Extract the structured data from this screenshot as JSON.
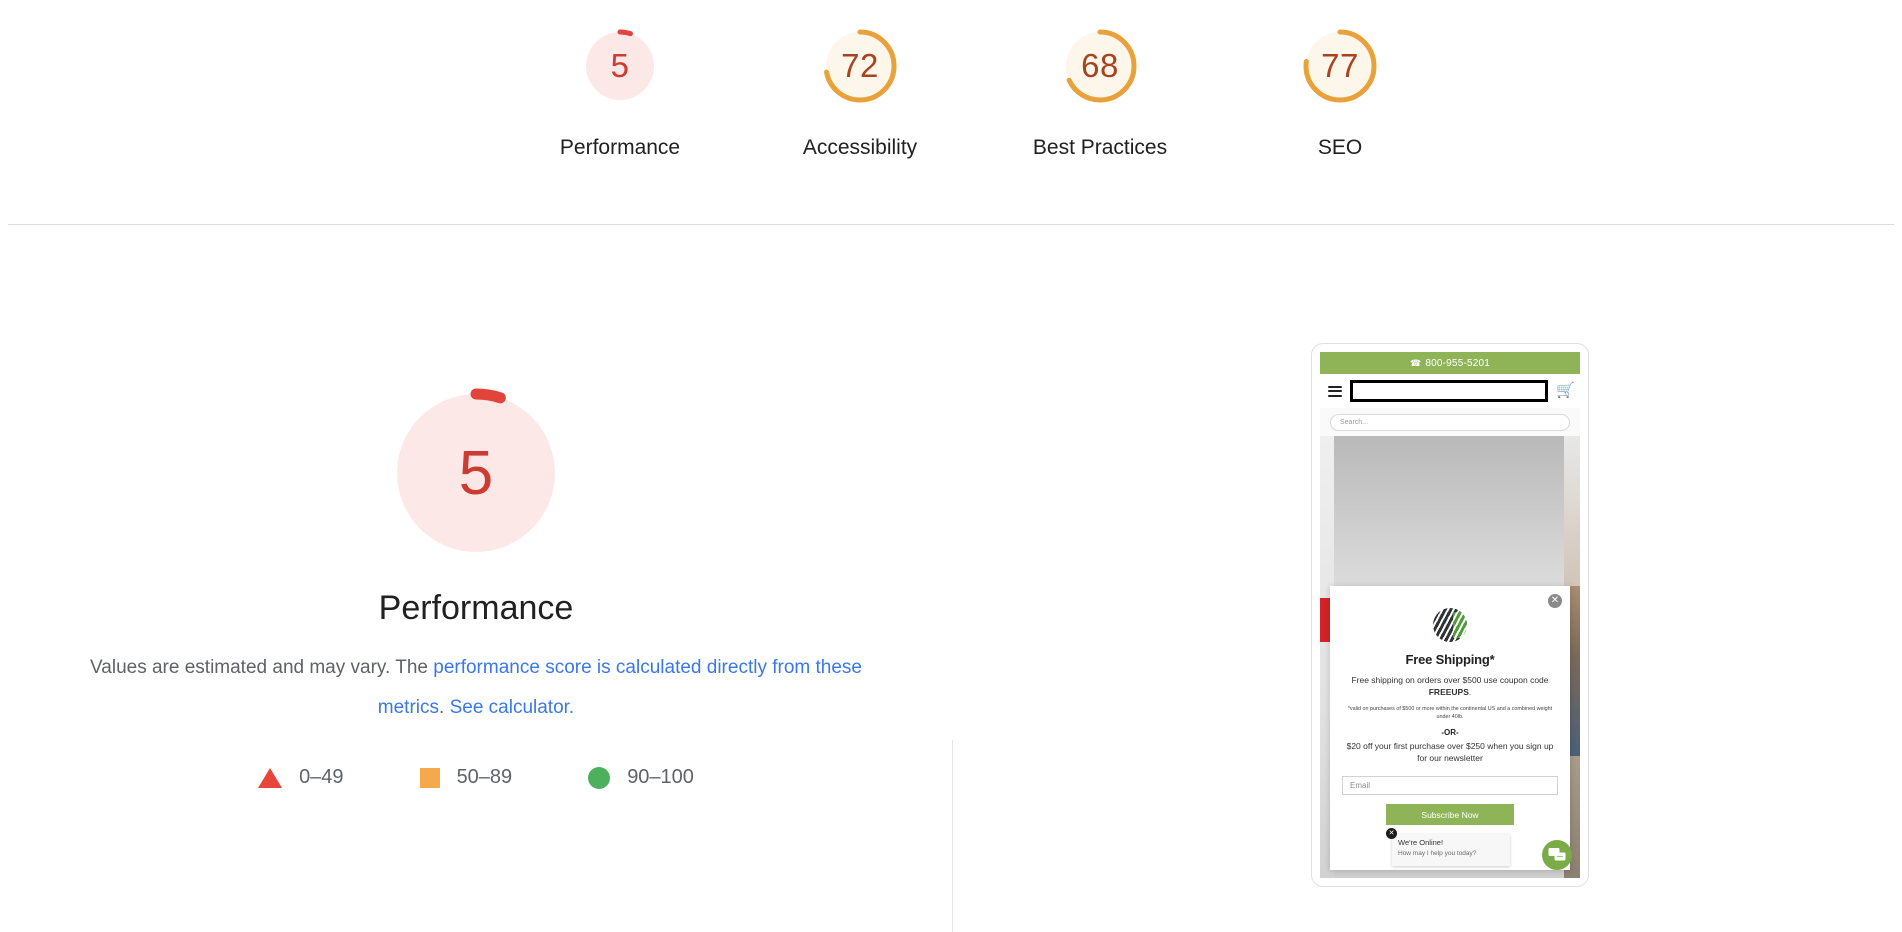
{
  "summary": {
    "gauges": [
      {
        "label": "Performance",
        "score": 5,
        "color": "#cc3c33",
        "track": "#fce9e7",
        "arc": "#e0443b",
        "filled_background": true
      },
      {
        "label": "Accessibility",
        "score": 72,
        "color": "#a8421f",
        "track": "#fdf6ea",
        "arc": "#e9a13b",
        "filled_background": false
      },
      {
        "label": "Best Practices",
        "score": 68,
        "color": "#a8421f",
        "track": "#fdf6ea",
        "arc": "#e9a13b",
        "filled_background": false
      },
      {
        "label": "SEO",
        "score": 77,
        "color": "#a8421f",
        "track": "#fdf6ea",
        "arc": "#e9a13b",
        "filled_background": false
      }
    ]
  },
  "category": {
    "gauge": {
      "score": 5,
      "color": "#cc3c33",
      "track": "#fce9e7",
      "arc": "#e0443b"
    },
    "title": "Performance",
    "description_prefix": "Values are estimated and may vary. The ",
    "description_link_1": "performance score is calculated directly from these metrics",
    "description_middle": ". ",
    "description_link_2": "See calculator.",
    "legend": [
      {
        "icon": "triangle-swatch",
        "range": "0–49",
        "color": "#e8453c"
      },
      {
        "icon": "square-swatch",
        "range": "50–89",
        "color": "#f5a84c"
      },
      {
        "icon": "circle-swatch",
        "range": "90–100",
        "color": "#4cb05c"
      }
    ]
  },
  "screenshot": {
    "topbar": {
      "icon": "phone-icon",
      "phone": "800-955-5201"
    },
    "nav": {
      "menu_icon": "hamburger-menu-icon",
      "cart_icon": "shopping-cart-icon"
    },
    "search": {
      "placeholder": "Search..."
    },
    "modal": {
      "close_icon": "close-icon",
      "logo_icon": "globe-logo-icon",
      "title": "Free Shipping*",
      "subtitle_prefix": "Free shipping on orders over $500 use coupon code ",
      "coupon_code": "FREEUPS",
      "subtitle_suffix": ".",
      "fine_print": "*valid on purchases of $500 or more within the continental US and a combined weight under 40lb.",
      "or_divider": "-OR-",
      "offer": "$20 off your first purchase over $250 when you sign up for our newsletter",
      "email_placeholder": "Email",
      "subscribe_label": "Subscribe Now"
    },
    "chat": {
      "close_icon": "chat-close-icon",
      "title": "We're Online!",
      "subtitle": "How may I help you today?",
      "bubble_icon": "chat-bubble-icon"
    }
  }
}
